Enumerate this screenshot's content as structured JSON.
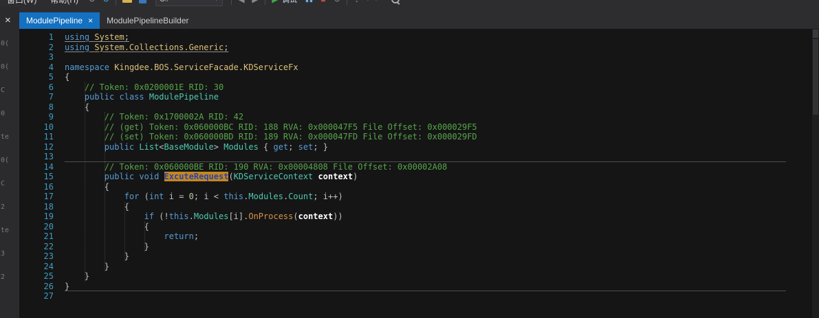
{
  "colors": {
    "active_tab": "#1470c0",
    "symbol_highlight_bg": "#c8861d",
    "editor_bg": "#151515",
    "comment": "#57a64a",
    "keyword": "#569cd6",
    "type": "#4ec9b0",
    "line_number": "#3f9cc4"
  },
  "toolbar": {
    "menus": [
      "窗口(W)",
      "帮助(H)"
    ],
    "language_combo": "C#",
    "start_label": "调试",
    "icon_glyphs": {
      "back": "↺",
      "forward": "↻",
      "nav_left": "◀",
      "nav_right": "▶",
      "start": "▶",
      "pause": "▮▮",
      "stop": "■",
      "restart": "↻",
      "step_down": "↓",
      "dropdown": "▼"
    }
  },
  "left_strip": {
    "close_glyph": "×",
    "fragments": [
      "0(",
      "0(",
      "C",
      "0",
      "te",
      "0(",
      "C",
      "2",
      "te",
      "3",
      "2"
    ]
  },
  "tabs": [
    {
      "label": "ModulePipeline",
      "active": true,
      "close_glyph": "×"
    },
    {
      "label": "ModulePipelineBuilder",
      "active": false
    }
  ],
  "editor": {
    "language": "C#",
    "highlighted_symbol": "ExcuteRequest",
    "lines": [
      {
        "n": 1,
        "u": true,
        "s": [
          [
            "k",
            "using"
          ],
          [
            "x",
            " "
          ],
          [
            "n",
            "System"
          ],
          [
            "x",
            ";"
          ]
        ]
      },
      {
        "n": 2,
        "u": true,
        "s": [
          [
            "k",
            "using"
          ],
          [
            "x",
            " "
          ],
          [
            "n",
            "System.Collections.Generic"
          ],
          [
            "x",
            ";"
          ]
        ]
      },
      {
        "n": 3,
        "s": []
      },
      {
        "n": 4,
        "s": [
          [
            "k",
            "namespace"
          ],
          [
            "x",
            " "
          ],
          [
            "n",
            "Kingdee.BOS.ServiceFacade.KDServiceFx"
          ]
        ]
      },
      {
        "n": 5,
        "s": [
          [
            "x",
            "{"
          ]
        ]
      },
      {
        "n": 6,
        "s": [
          [
            "x",
            "    "
          ],
          [
            "c",
            "// Token: 0x0200001E RID: 30"
          ]
        ]
      },
      {
        "n": 7,
        "s": [
          [
            "x",
            "    "
          ],
          [
            "k",
            "public"
          ],
          [
            "x",
            " "
          ],
          [
            "k",
            "class"
          ],
          [
            "x",
            " "
          ],
          [
            "t",
            "ModulePipeline"
          ]
        ]
      },
      {
        "n": 8,
        "s": [
          [
            "x",
            "    {"
          ]
        ]
      },
      {
        "n": 9,
        "s": [
          [
            "x",
            "        "
          ],
          [
            "c",
            "// Token: 0x1700002A RID: 42"
          ]
        ]
      },
      {
        "n": 10,
        "s": [
          [
            "x",
            "        "
          ],
          [
            "c",
            "// (get) Token: 0x060000BC RID: 188 RVA: 0x000047F5 File Offset: 0x000029F5"
          ]
        ]
      },
      {
        "n": 11,
        "s": [
          [
            "x",
            "        "
          ],
          [
            "c",
            "// (set) Token: 0x060000BD RID: 189 RVA: 0x000047FD File Offset: 0x000029FD"
          ]
        ]
      },
      {
        "n": 12,
        "s": [
          [
            "x",
            "        "
          ],
          [
            "k",
            "public"
          ],
          [
            "x",
            " "
          ],
          [
            "t",
            "List"
          ],
          [
            "x",
            "<"
          ],
          [
            "t",
            "BaseModule"
          ],
          [
            "x",
            "> "
          ],
          [
            "t",
            "Modules"
          ],
          [
            "x",
            " { "
          ],
          [
            "k",
            "get"
          ],
          [
            "x",
            "; "
          ],
          [
            "k",
            "set"
          ],
          [
            "x",
            "; }"
          ]
        ]
      },
      {
        "n": 13,
        "s": [],
        "ruler": true
      },
      {
        "n": 14,
        "s": [
          [
            "x",
            "        "
          ],
          [
            "c",
            "// Token: 0x060000BE RID: 190 RVA: 0x00004808 File Offset: 0x00002A08"
          ]
        ]
      },
      {
        "n": 15,
        "s": [
          [
            "x",
            "        "
          ],
          [
            "k",
            "public"
          ],
          [
            "x",
            " "
          ],
          [
            "k",
            "void"
          ],
          [
            "x",
            " "
          ],
          [
            "h",
            "ExcuteRequest"
          ],
          [
            "x",
            "("
          ],
          [
            "t",
            "KDServiceContext"
          ],
          [
            "x",
            " "
          ],
          [
            "p",
            "context"
          ],
          [
            "x",
            ")"
          ]
        ]
      },
      {
        "n": 16,
        "s": [
          [
            "x",
            "        {"
          ]
        ]
      },
      {
        "n": 17,
        "s": [
          [
            "x",
            "            "
          ],
          [
            "k",
            "for"
          ],
          [
            "x",
            " ("
          ],
          [
            "k",
            "int"
          ],
          [
            "x",
            " i = "
          ],
          [
            "d",
            "0"
          ],
          [
            "x",
            "; i < "
          ],
          [
            "k",
            "this"
          ],
          [
            "x",
            "."
          ],
          [
            "t",
            "Modules"
          ],
          [
            "x",
            "."
          ],
          [
            "t",
            "Count"
          ],
          [
            "x",
            "; i++)"
          ]
        ]
      },
      {
        "n": 18,
        "s": [
          [
            "x",
            "            {"
          ]
        ]
      },
      {
        "n": 19,
        "s": [
          [
            "x",
            "                "
          ],
          [
            "k",
            "if"
          ],
          [
            "x",
            " (!"
          ],
          [
            "k",
            "this"
          ],
          [
            "x",
            "."
          ],
          [
            "t",
            "Modules"
          ],
          [
            "x",
            "[i]."
          ],
          [
            "m",
            "OnProcess"
          ],
          [
            "x",
            "("
          ],
          [
            "p",
            "context"
          ],
          [
            "x",
            "))"
          ]
        ]
      },
      {
        "n": 20,
        "s": [
          [
            "x",
            "                {"
          ]
        ]
      },
      {
        "n": 21,
        "s": [
          [
            "x",
            "                    "
          ],
          [
            "k",
            "return"
          ],
          [
            "x",
            ";"
          ]
        ]
      },
      {
        "n": 22,
        "s": [
          [
            "x",
            "                }"
          ]
        ]
      },
      {
        "n": 23,
        "s": [
          [
            "x",
            "            }"
          ]
        ]
      },
      {
        "n": 24,
        "s": [
          [
            "x",
            "        }"
          ]
        ]
      },
      {
        "n": 25,
        "s": [
          [
            "x",
            "    }"
          ]
        ]
      },
      {
        "n": 26,
        "s": [
          [
            "x",
            "}"
          ]
        ],
        "ruler": true
      },
      {
        "n": 27,
        "s": []
      }
    ]
  }
}
